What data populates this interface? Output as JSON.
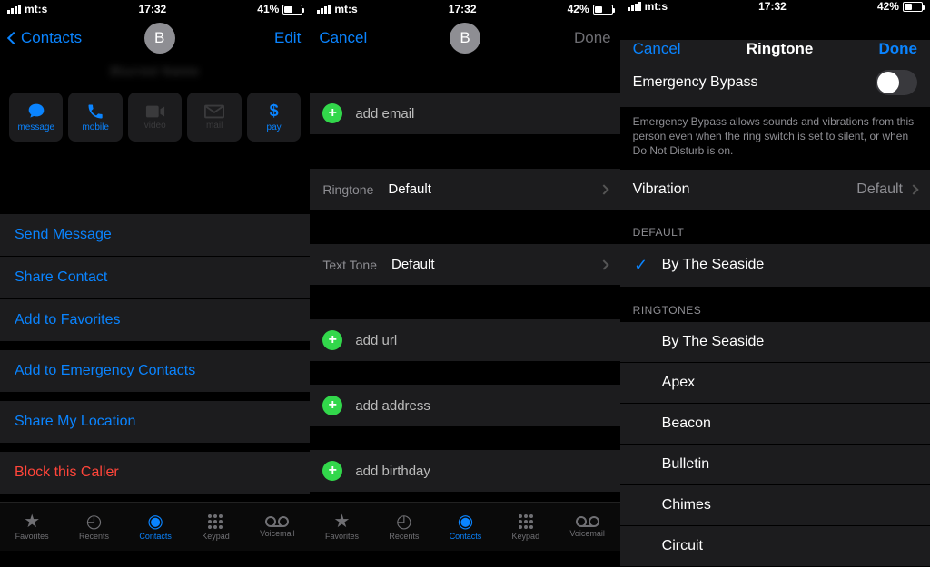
{
  "status": {
    "carrier": "mt:s",
    "time": "17:32",
    "battery1": "41%",
    "battery2": "42%",
    "battery3": "42%",
    "battery_fill": "41%"
  },
  "screen1": {
    "back": "Contacts",
    "edit": "Edit",
    "avatar_letter": "B",
    "blurred_name": "Blurred Name",
    "actions": {
      "message": "message",
      "mobile": "mobile",
      "video": "video",
      "mail": "mail",
      "pay": "pay"
    },
    "items": {
      "send_message": "Send Message",
      "share_contact": "Share Contact",
      "add_favorites": "Add to Favorites",
      "add_emergency": "Add to Emergency Contacts",
      "share_location": "Share My Location",
      "block_caller": "Block this Caller"
    }
  },
  "screen2": {
    "cancel": "Cancel",
    "done": "Done",
    "avatar_letter": "B",
    "add_email": "add email",
    "ringtone_label": "Ringtone",
    "ringtone_value": "Default",
    "text_tone_label": "Text Tone",
    "text_tone_value": "Default",
    "add_url": "add url",
    "add_address": "add address",
    "add_birthday": "add birthday"
  },
  "screen3": {
    "cancel": "Cancel",
    "title": "Ringtone",
    "done": "Done",
    "emergency_bypass": "Emergency Bypass",
    "bypass_desc": "Emergency Bypass allows sounds and vibrations from this person even when the ring switch is set to silent, or when Do Not Disturb is on.",
    "vibration_label": "Vibration",
    "vibration_value": "Default",
    "default_header": "Default",
    "selected_ringtone": "By The Seaside",
    "ringtones_header": "Ringtones",
    "ringtones": [
      "By The Seaside",
      "Apex",
      "Beacon",
      "Bulletin",
      "Chimes",
      "Circuit"
    ]
  },
  "tabbar": {
    "favorites": "Favorites",
    "recents": "Recents",
    "contacts": "Contacts",
    "keypad": "Keypad",
    "voicemail": "Voicemail"
  }
}
